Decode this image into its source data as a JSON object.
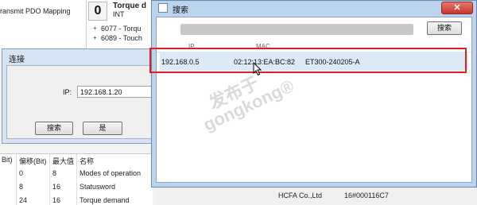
{
  "background": {
    "left_lines": [
      "ransmit PDO Mapping"
    ],
    "pdo_index": "0",
    "pdo_title": "Torque d",
    "pdo_type": "INT",
    "tree_items": [
      "6077 - Torqu",
      "6089 - Touch"
    ],
    "table_headers": [
      "Bit)",
      "偏移(Bit)",
      "最大值",
      "名称"
    ],
    "table_rows": [
      {
        "offset": "0",
        "max": "8",
        "name": "Modes of operation"
      },
      {
        "offset": "8",
        "max": "16",
        "name": "Statusword"
      },
      {
        "offset": "24",
        "max": "16",
        "name": "Torque demand"
      }
    ],
    "bottom_vendor": "HCFA Co.,Ltd",
    "bottom_code": "16#000116C7"
  },
  "connect_dialog": {
    "title": "连接",
    "ip_label": "IP:",
    "ip_value": "192.168.1.20",
    "search_button": "搜索",
    "ok_button": "是"
  },
  "search_window": {
    "title": "搜索",
    "search_button": "搜索",
    "columns": [
      "IP",
      "MAC"
    ],
    "devices": [
      {
        "ip": "192.168.0.5",
        "mac": "02:12:13:EA:BC:82",
        "name": "ET300-240205-A"
      }
    ]
  },
  "watermark": {
    "line1": "发布于",
    "line2": "gongkong®"
  }
}
